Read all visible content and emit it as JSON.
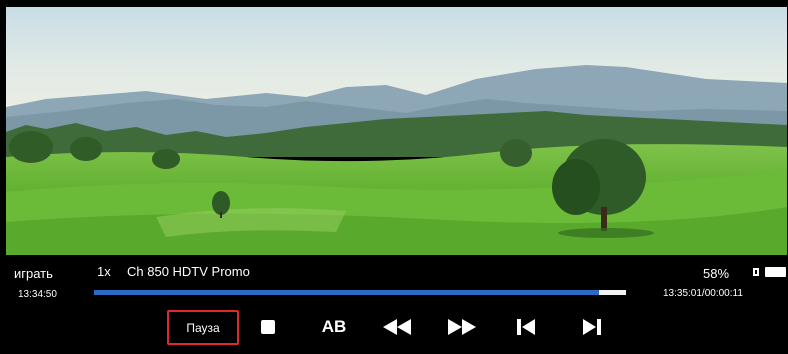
{
  "player": {
    "mode_label": "играть",
    "speed": "1x",
    "channel_title": "Ch 850 HDTV Promo",
    "start_time": "13:34:50",
    "percent": "58%",
    "time_info": "13:35:01/00:00:11",
    "progress": 0.95,
    "battery_icon": "battery-icon"
  },
  "controls": {
    "pause_label": "Пауза",
    "stop_icon": "stop-icon",
    "ab_label": "AB",
    "rewind_icon": "rewind-icon",
    "fast_forward_icon": "fast-forward-icon",
    "previous_icon": "skip-previous-icon",
    "next_icon": "skip-next-icon"
  },
  "colors": {
    "progress_fill": "#2a6cc4",
    "progress_track": "#f2f2f2",
    "focus_border": "#e0292b"
  }
}
